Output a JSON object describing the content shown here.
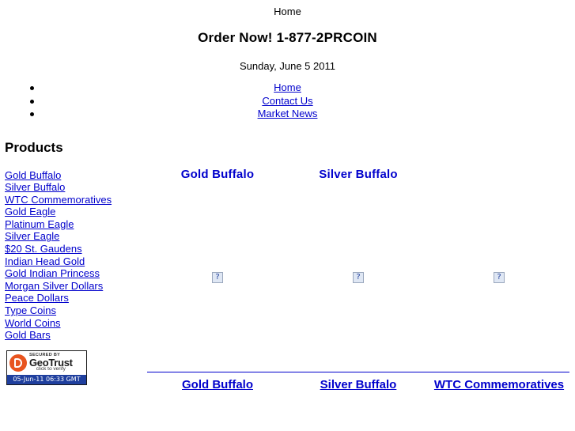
{
  "header": {
    "top_link": "Home",
    "order_now": "Order Now! 1-877-2PRCOIN",
    "date": "Sunday, June 5 2011"
  },
  "nav": {
    "items": [
      {
        "label": "Home"
      },
      {
        "label": "Contact Us"
      },
      {
        "label": "Market News"
      }
    ]
  },
  "sidebar": {
    "heading": "Products",
    "items": [
      {
        "label": "Gold Buffalo"
      },
      {
        "label": "Silver Buffalo"
      },
      {
        "label": "WTC Commemoratives"
      },
      {
        "label": "Gold Eagle"
      },
      {
        "label": "Platinum Eagle"
      },
      {
        "label": "Silver Eagle"
      },
      {
        "label": "$20 St. Gaudens"
      },
      {
        "label": "Indian Head Gold"
      },
      {
        "label": "Gold Indian Princess"
      },
      {
        "label": "Morgan Silver Dollars"
      },
      {
        "label": "Peace Dollars"
      },
      {
        "label": "Type Coins"
      },
      {
        "label": "World Coins"
      },
      {
        "label": "Gold Bars"
      }
    ],
    "seal": {
      "secured_by": "SECURED BY",
      "brand": "GeoTrust",
      "verify": "click to verify",
      "timestamp": "05-Jun-11 06:33 GMT"
    }
  },
  "main": {
    "columns": [
      {
        "title": "Gold Buffalo",
        "image_alt": "?",
        "caption": "Gold Buffalo"
      },
      {
        "title": "Silver Buffalo",
        "image_alt": "?",
        "caption": "Silver Buffalo"
      },
      {
        "title": "",
        "image_alt": "?",
        "caption": "WTC Commemoratives"
      }
    ]
  },
  "colors": {
    "link": "#0000cc",
    "seal_orange": "#e8541f",
    "seal_bar": "#1f3f9e"
  }
}
